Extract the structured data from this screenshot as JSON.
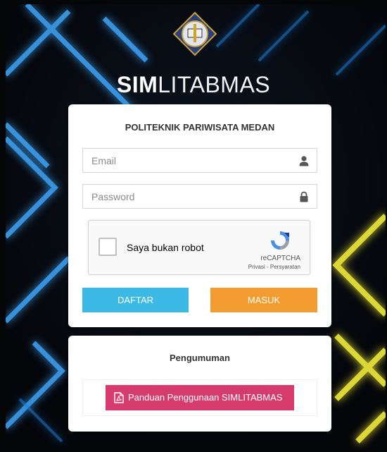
{
  "brand": {
    "bold": "SIM",
    "light": "LITABMAS"
  },
  "login": {
    "institution": "POLITEKNIK PARIWISATA MEDAN",
    "email_placeholder": "Email",
    "password_placeholder": "Password",
    "recaptcha": {
      "checkbox_label": "Saya bukan robot",
      "brand": "reCAPTCHA",
      "links": "Privasi - Persyaratan"
    },
    "register_label": "DAFTAR",
    "login_label": "MASUK"
  },
  "announcement": {
    "title": "Pengumuman",
    "guide_button_label": "Panduan Penggunaan SIMLITABMAS"
  },
  "icons": {
    "email_field": "user-icon",
    "password_field": "lock-icon",
    "guide_button": "pdf-file-icon"
  },
  "colors": {
    "register_button": "#3db9e5",
    "login_button": "#f39c2f",
    "guide_button": "#d63b6e"
  }
}
